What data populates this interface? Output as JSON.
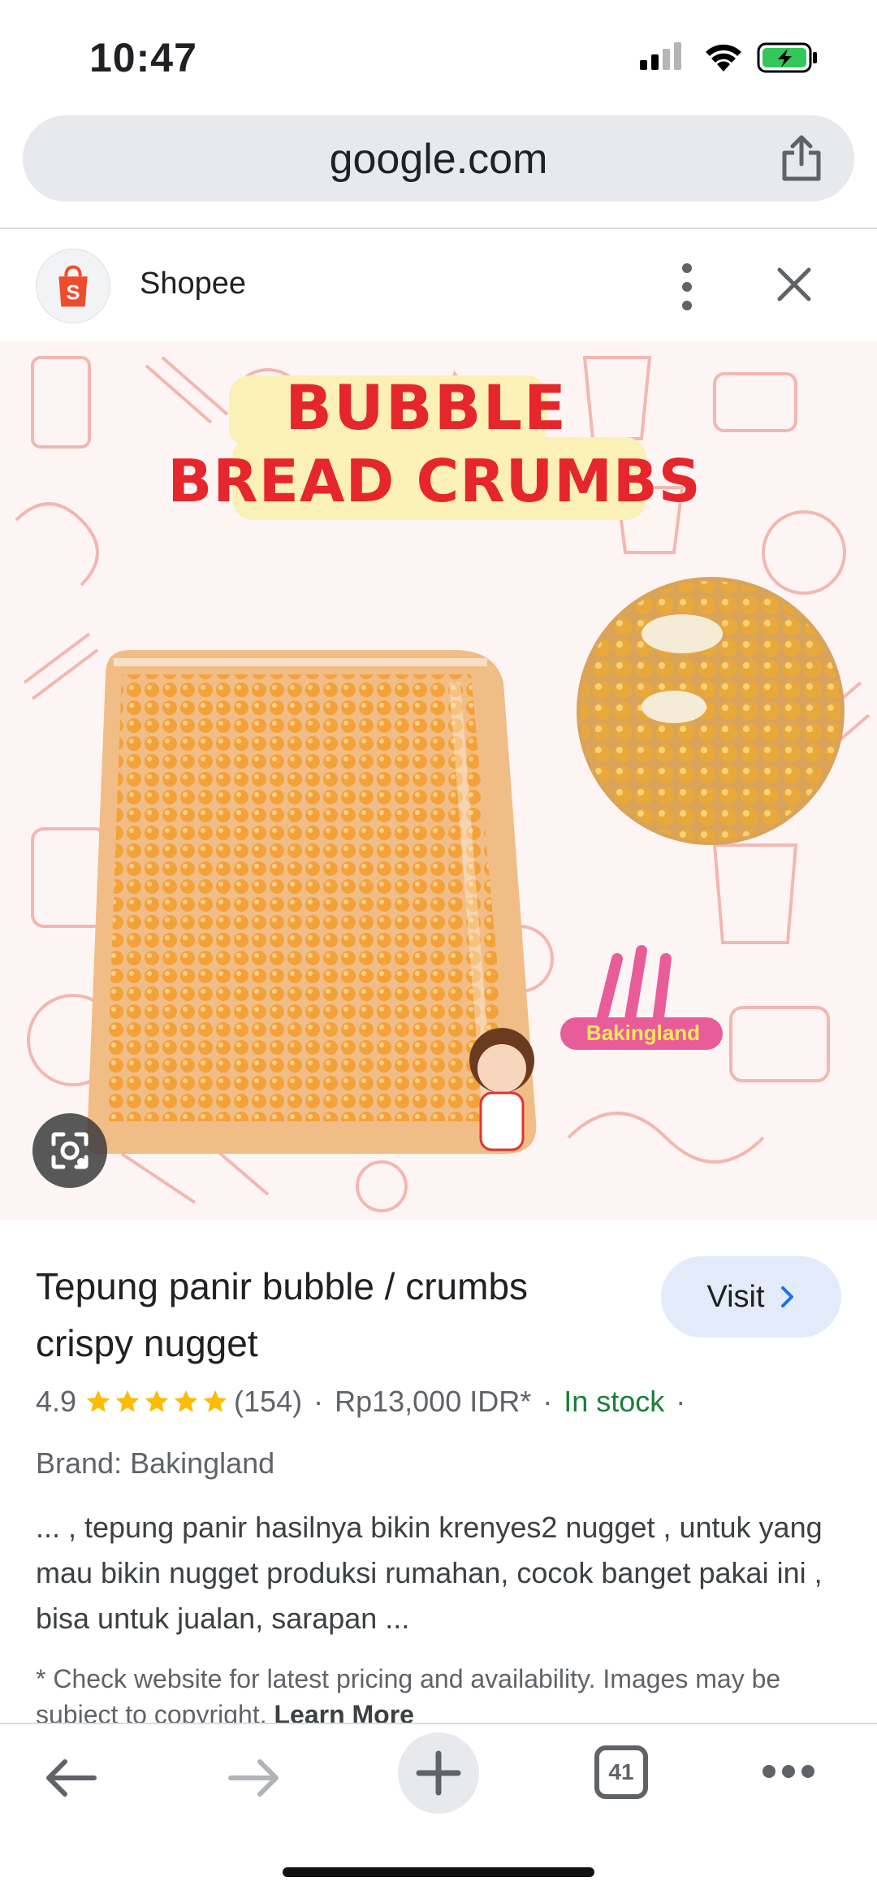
{
  "status_bar": {
    "time": "10:47"
  },
  "address_bar": {
    "url": "google.com"
  },
  "source": {
    "name": "Shopee"
  },
  "hero": {
    "banner_line1": "BUBBLE",
    "banner_line2": "BREAD CRUMBS",
    "watermark": "Bakingland"
  },
  "result": {
    "title": "Tepung panir bubble / crumbs crispy nugget",
    "visit_label": "Visit",
    "rating": "4.9",
    "rating_value": 4.9,
    "review_count": "(154)",
    "price": "Rp13,000 IDR*",
    "availability": "In stock",
    "brand": "Brand: Bakingland",
    "snippet": "... , tepung panir hasilnya bikin krenyes2 nugget , untuk yang mau bikin nugget produksi rumahan, cocok banget pakai ini , bisa untuk jualan, sarapan ...",
    "disclaimer": "* Check website for latest pricing and availability. Images may be subject to copyright.",
    "learn_more": "Learn More"
  },
  "toolbar": {
    "tab_count": "41"
  },
  "colors": {
    "accent_blue": "#1a73e8",
    "visit_bg": "#e3ebfb",
    "in_stock_green": "#188038",
    "star_yellow": "#fbbc04",
    "shopee_orange": "#ee4d2d"
  },
  "icons": [
    "signal-icon",
    "wifi-icon",
    "battery-icon",
    "share-icon",
    "shopee-logo",
    "more-vert-icon",
    "close-icon",
    "lens-icon",
    "chevron-right-icon",
    "star-icon",
    "back-icon",
    "forward-icon",
    "plus-icon",
    "tabs-icon",
    "more-horiz-icon"
  ]
}
